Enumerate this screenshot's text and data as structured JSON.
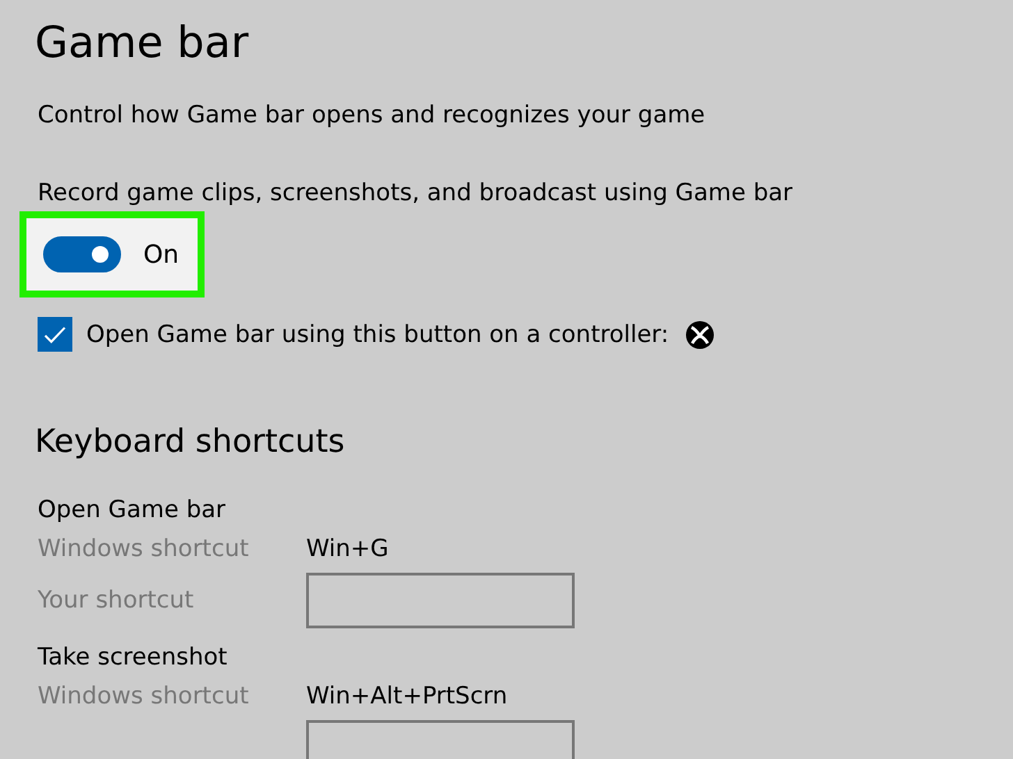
{
  "title": "Game bar",
  "description": "Control how Game bar opens and recognizes your game",
  "record": {
    "label": "Record game clips, screenshots, and broadcast using Game bar",
    "on": true,
    "state_label": "On",
    "highlighted": true
  },
  "controller_option": {
    "label": "Open Game bar using this button on a controller:",
    "checked": true
  },
  "shortcuts": {
    "heading": "Keyboard shortcuts",
    "groups": [
      {
        "name": "Open Game bar",
        "rows": [
          {
            "kind": "text",
            "label": "Windows shortcut",
            "value": "Win+G"
          },
          {
            "kind": "field",
            "label": "Your shortcut"
          }
        ]
      },
      {
        "name": "Take screenshot",
        "rows": [
          {
            "kind": "text",
            "label": "Windows shortcut",
            "value": "Win+Alt+PrtScrn"
          },
          {
            "kind": "field"
          }
        ]
      }
    ]
  }
}
